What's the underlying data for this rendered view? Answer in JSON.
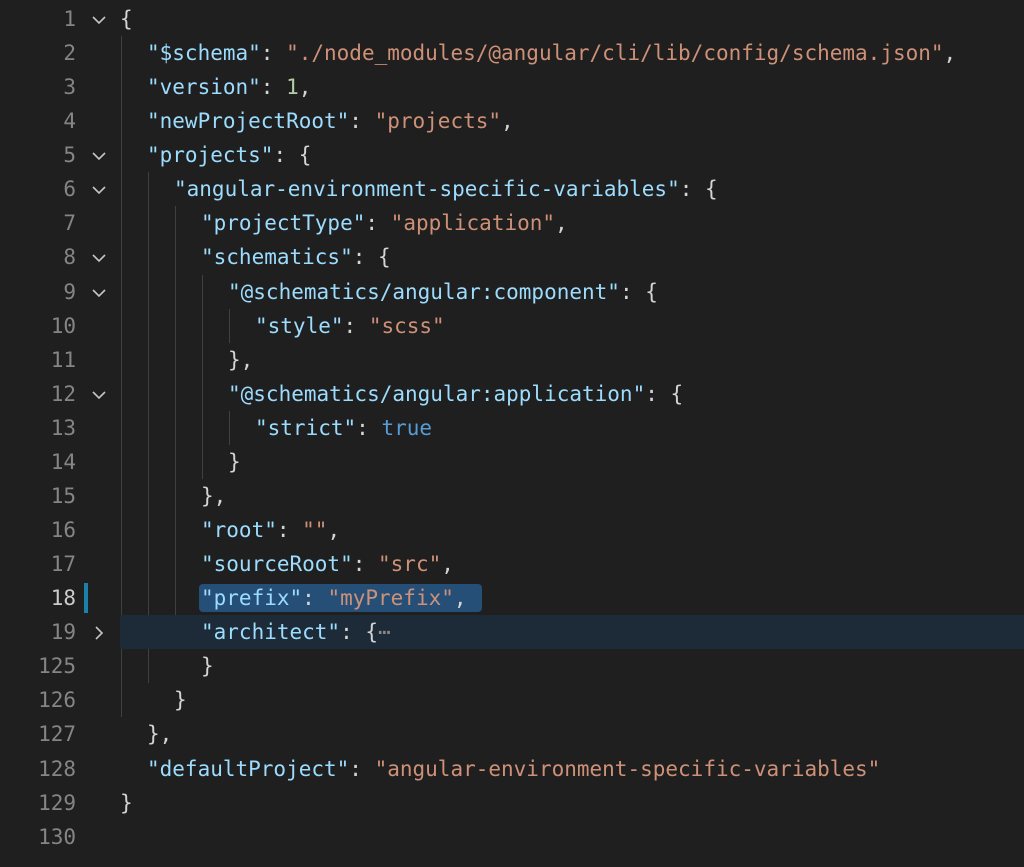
{
  "editor": {
    "lines": [
      {
        "num": "1",
        "fold": "open",
        "indent": 0,
        "tokens": [
          {
            "t": "{",
            "c": "punct"
          }
        ]
      },
      {
        "num": "2",
        "fold": "",
        "indent": 1,
        "tokens": [
          {
            "t": "\"$schema\"",
            "c": "key"
          },
          {
            "t": ": ",
            "c": "punct"
          },
          {
            "t": "\"./node_modules/@angular/cli/lib/config/schema.json\"",
            "c": "str"
          },
          {
            "t": ",",
            "c": "punct"
          }
        ]
      },
      {
        "num": "3",
        "fold": "",
        "indent": 1,
        "tokens": [
          {
            "t": "\"version\"",
            "c": "key"
          },
          {
            "t": ": ",
            "c": "punct"
          },
          {
            "t": "1",
            "c": "num"
          },
          {
            "t": ",",
            "c": "punct"
          }
        ]
      },
      {
        "num": "4",
        "fold": "",
        "indent": 1,
        "tokens": [
          {
            "t": "\"newProjectRoot\"",
            "c": "key"
          },
          {
            "t": ": ",
            "c": "punct"
          },
          {
            "t": "\"projects\"",
            "c": "str"
          },
          {
            "t": ",",
            "c": "punct"
          }
        ]
      },
      {
        "num": "5",
        "fold": "open",
        "indent": 1,
        "tokens": [
          {
            "t": "\"projects\"",
            "c": "key"
          },
          {
            "t": ": {",
            "c": "punct"
          }
        ]
      },
      {
        "num": "6",
        "fold": "open",
        "indent": 2,
        "tokens": [
          {
            "t": "\"angular-environment-specific-variables\"",
            "c": "key"
          },
          {
            "t": ": {",
            "c": "punct"
          }
        ]
      },
      {
        "num": "7",
        "fold": "",
        "indent": 3,
        "tokens": [
          {
            "t": "\"projectType\"",
            "c": "key"
          },
          {
            "t": ": ",
            "c": "punct"
          },
          {
            "t": "\"application\"",
            "c": "str"
          },
          {
            "t": ",",
            "c": "punct"
          }
        ]
      },
      {
        "num": "8",
        "fold": "open",
        "indent": 3,
        "tokens": [
          {
            "t": "\"schematics\"",
            "c": "key"
          },
          {
            "t": ": {",
            "c": "punct"
          }
        ]
      },
      {
        "num": "9",
        "fold": "open",
        "indent": 4,
        "tokens": [
          {
            "t": "\"@schematics/angular:component\"",
            "c": "key"
          },
          {
            "t": ": {",
            "c": "punct"
          }
        ]
      },
      {
        "num": "10",
        "fold": "",
        "indent": 5,
        "tokens": [
          {
            "t": "\"style\"",
            "c": "key"
          },
          {
            "t": ": ",
            "c": "punct"
          },
          {
            "t": "\"scss\"",
            "c": "str"
          }
        ]
      },
      {
        "num": "11",
        "fold": "",
        "indent": 4,
        "tokens": [
          {
            "t": "},",
            "c": "punct"
          }
        ]
      },
      {
        "num": "12",
        "fold": "open",
        "indent": 4,
        "tokens": [
          {
            "t": "\"@schematics/angular:application\"",
            "c": "key"
          },
          {
            "t": ": {",
            "c": "punct"
          }
        ]
      },
      {
        "num": "13",
        "fold": "",
        "indent": 5,
        "tokens": [
          {
            "t": "\"strict\"",
            "c": "key"
          },
          {
            "t": ": ",
            "c": "punct"
          },
          {
            "t": "true",
            "c": "bool"
          }
        ]
      },
      {
        "num": "14",
        "fold": "",
        "indent": 4,
        "tokens": [
          {
            "t": "}",
            "c": "punct"
          }
        ]
      },
      {
        "num": "15",
        "fold": "",
        "indent": 3,
        "tokens": [
          {
            "t": "},",
            "c": "punct"
          }
        ]
      },
      {
        "num": "16",
        "fold": "",
        "indent": 3,
        "tokens": [
          {
            "t": "\"root\"",
            "c": "key"
          },
          {
            "t": ": ",
            "c": "punct"
          },
          {
            "t": "\"\"",
            "c": "str"
          },
          {
            "t": ",",
            "c": "punct"
          }
        ]
      },
      {
        "num": "17",
        "fold": "",
        "indent": 3,
        "tokens": [
          {
            "t": "\"sourceRoot\"",
            "c": "key"
          },
          {
            "t": ": ",
            "c": "punct"
          },
          {
            "t": "\"src\"",
            "c": "str"
          },
          {
            "t": ",",
            "c": "punct"
          }
        ]
      },
      {
        "num": "18",
        "fold": "",
        "indent": 3,
        "active": true,
        "tokens": [
          {
            "t": "\"prefix\"",
            "c": "key"
          },
          {
            "t": ": ",
            "c": "punct"
          },
          {
            "t": "\"myPrefix\"",
            "c": "str"
          },
          {
            "t": ",",
            "c": "punct"
          }
        ]
      },
      {
        "num": "19",
        "fold": "closed",
        "indent": 3,
        "current": true,
        "tokens": [
          {
            "t": "\"architect\"",
            "c": "key"
          },
          {
            "t": ": {",
            "c": "punct"
          },
          {
            "t": "⋯",
            "c": "ellipsis"
          }
        ]
      },
      {
        "num": "125",
        "fold": "",
        "indent": 3,
        "tokens": [
          {
            "t": "}",
            "c": "punct"
          }
        ]
      },
      {
        "num": "126",
        "fold": "",
        "indent": 2,
        "tokens": [
          {
            "t": "}",
            "c": "punct"
          }
        ]
      },
      {
        "num": "127",
        "fold": "",
        "indent": 1,
        "tokens": [
          {
            "t": "},",
            "c": "punct"
          }
        ]
      },
      {
        "num": "128",
        "fold": "",
        "indent": 1,
        "tokens": [
          {
            "t": "\"defaultProject\"",
            "c": "key"
          },
          {
            "t": ": ",
            "c": "punct"
          },
          {
            "t": "\"angular-environment-specific-variables\"",
            "c": "str"
          }
        ]
      },
      {
        "num": "129",
        "fold": "",
        "indent": 0,
        "tokens": [
          {
            "t": "}",
            "c": "punct"
          }
        ]
      },
      {
        "num": "130",
        "fold": "",
        "indent": 0,
        "tokens": []
      }
    ]
  },
  "colors": {
    "background": "#1f1f1f",
    "key": "#9cdcfe",
    "string": "#ce9178",
    "number": "#b5cea8",
    "boolean": "#569cd6",
    "selection": "#264f78",
    "modified_bar": "#1b81a8"
  }
}
